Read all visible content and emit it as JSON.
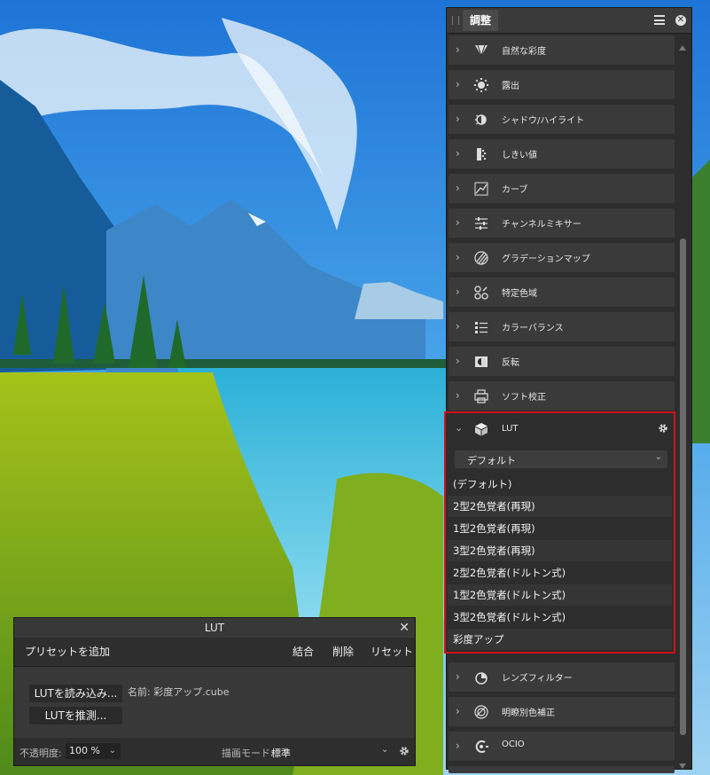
{
  "panel": {
    "tab_label": "調整",
    "items_top": [
      {
        "label": "自然な彩度",
        "icon": "vibrance-icon"
      },
      {
        "label": "露出",
        "icon": "exposure-icon"
      },
      {
        "label": "シャドウ/ハイライト",
        "icon": "shadows-highlights-icon"
      },
      {
        "label": "しきい値",
        "icon": "threshold-icon"
      },
      {
        "label": "カーブ",
        "icon": "curves-icon"
      },
      {
        "label": "チャンネルミキサー",
        "icon": "channel-mixer-icon"
      },
      {
        "label": "グラデーションマップ",
        "icon": "gradient-map-icon"
      },
      {
        "label": "特定色域",
        "icon": "selective-color-icon"
      },
      {
        "label": "カラーバランス",
        "icon": "color-balance-icon"
      },
      {
        "label": "反転",
        "icon": "invert-icon"
      },
      {
        "label": "ソフト校正",
        "icon": "soft-proof-icon"
      }
    ],
    "items_bottom": [
      {
        "label": "レンズフィルター",
        "icon": "lens-filter-icon"
      },
      {
        "label": "明瞭別色補正",
        "icon": "split-toning-icon"
      },
      {
        "label": "OCIO",
        "icon": "ocio-icon"
      }
    ]
  },
  "lut": {
    "label": "LUT",
    "selected": "デフォルト",
    "options": [
      "(デフォルト)",
      "2型2色覚者(再現)",
      "1型2色覚者(再現)",
      "3型2色覚者(再現)",
      "2型2色覚者(ドルトン式)",
      "1型2色覚者(ドルトン式)",
      "3型2色覚者(ドルトン式)",
      "彩度アップ"
    ],
    "highlight_color": "#d0121b"
  },
  "dialog": {
    "title": "LUT",
    "add_preset": "プリセットを追加",
    "merge": "結合",
    "delete": "削除",
    "reset": "リセット",
    "load_lut": "LUTを読み込み...",
    "infer_lut": "LUTを推測...",
    "name_label": "名前: 彩度アップ.cube",
    "opacity_label": "不透明度:",
    "opacity_value": "100 %",
    "blend_label": "描画モード:",
    "blend_value": "標準"
  }
}
